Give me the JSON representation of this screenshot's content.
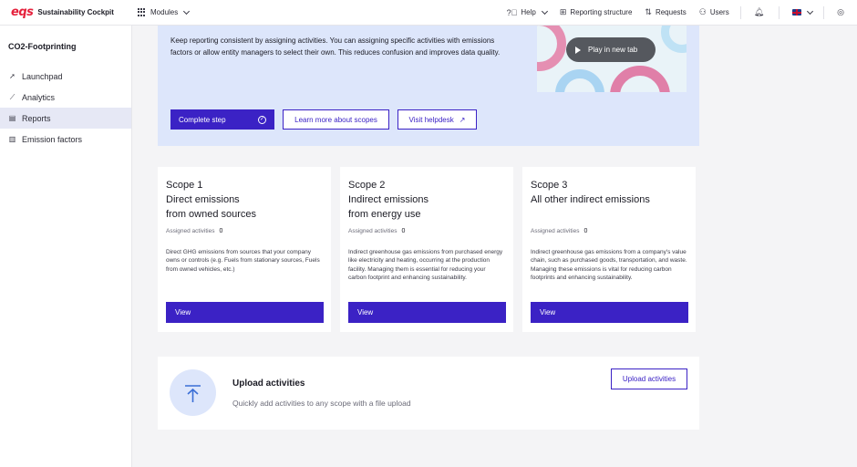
{
  "header": {
    "logo_mark": "eqs",
    "app_name": "Sustainability Cockpit",
    "modules_label": "Modules",
    "help_label": "Help",
    "reporting_structure_label": "Reporting structure",
    "requests_label": "Requests",
    "users_label": "Users"
  },
  "sidebar": {
    "title": "CO2-Footprinting",
    "items": [
      {
        "label": "Launchpad",
        "icon": "rocket-icon"
      },
      {
        "label": "Analytics",
        "icon": "chart-icon"
      },
      {
        "label": "Reports",
        "icon": "report-icon",
        "active": true
      },
      {
        "label": "Emission factors",
        "icon": "factor-icon"
      }
    ]
  },
  "intro": {
    "text": "Keep reporting consistent by assigning activities. You can assigning specific activities with emissions factors or allow entity managers to select their own. This reduces confusion and improves data quality.",
    "video_button": "Play in new tab",
    "complete_step": "Complete step",
    "learn_more": "Learn more about scopes",
    "helpdesk": "Visit helpdesk"
  },
  "scopes": [
    {
      "title": "Scope 1",
      "subtitle_line1": "Direct emissions",
      "subtitle_line2": "from owned sources",
      "assigned_label": "Assigned activities",
      "assigned_count": "0",
      "description": "Direct GHG emissions from sources that your company owns or controls (e.g.  Fuels from stationary sources, Fuels from owned vehicles, etc.)",
      "button": "View"
    },
    {
      "title": "Scope 2",
      "subtitle_line1": "Indirect emissions",
      "subtitle_line2": "from energy use",
      "assigned_label": "Assigned activities",
      "assigned_count": "0",
      "description": "Indirect greenhouse gas emissions from purchased energy like electricity and heating, occurring at the production facility. Managing them is essential for reducing your carbon footprint and enhancing sustainability.",
      "button": "View"
    },
    {
      "title": "Scope 3",
      "subtitle_line1": "All other indirect emissions",
      "subtitle_line2": "",
      "assigned_label": "Assigned activities",
      "assigned_count": "0",
      "description": "Indirect greenhouse gas emissions from a company's value chain, such as purchased goods, transportation, and waste. Managing these emissions is vital for reducing carbon footprints and enhancing sustainability.",
      "button": "View"
    }
  ],
  "upload": {
    "title": "Upload activities",
    "subtitle": "Quickly add activities to any scope with a file upload",
    "button": "Upload activities"
  },
  "colors": {
    "accent": "#3b22c5",
    "banner_bg": "#dde6fb",
    "brand_red": "#e5213c"
  }
}
